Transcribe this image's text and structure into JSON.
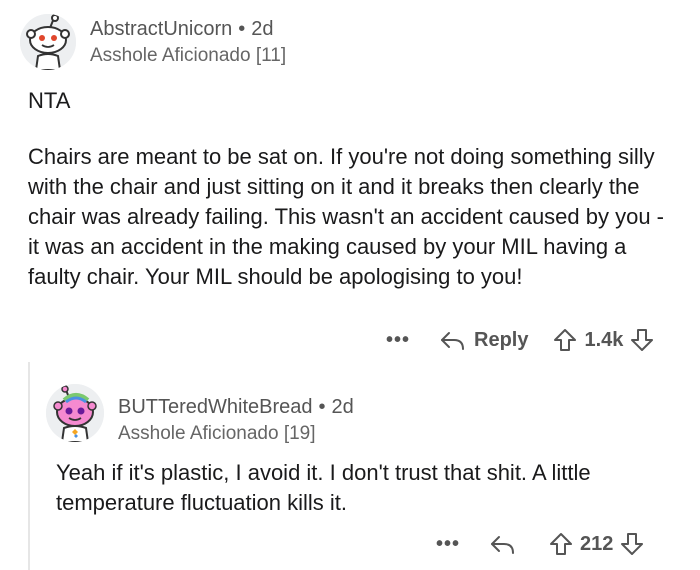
{
  "comment1": {
    "author": "AbstractUnicorn",
    "separator": "•",
    "age": "2d",
    "flair": "Asshole Aficionado [11]",
    "lead": "NTA",
    "body": "Chairs are meant to be sat on. If you're not doing something silly with the chair and just sitting on it and it breaks then clearly the chair was already failing. This wasn't an accident caused by you - it was an accident in the making caused by your MIL having a faulty chair. Your MIL should be apologising to you!",
    "more_label": "•••",
    "reply_label": "Reply",
    "score": "1.4k"
  },
  "comment2": {
    "author": "BUTTeredWhiteBread",
    "separator": "•",
    "age": "2d",
    "flair": "Asshole Aficionado [19]",
    "body": "Yeah if it's plastic, I avoid it. I don't trust that shit. A little temperature fluctuation kills it.",
    "more_label": "•••",
    "score": "212"
  },
  "icons": {
    "reply": "reply-arrow-icon",
    "upvote": "upvote-arrow-icon",
    "downvote": "downvote-arrow-icon",
    "more": "more-options-icon"
  },
  "colors": {
    "text": "#1a1a1b",
    "meta": "#555555",
    "thread_line": "#e6e6e6"
  }
}
